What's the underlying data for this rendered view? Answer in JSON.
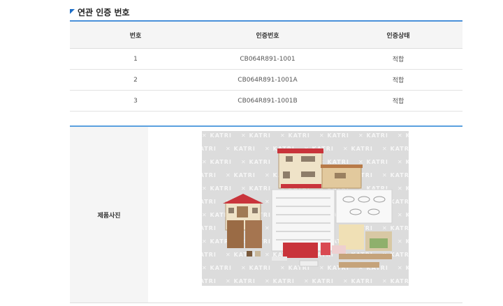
{
  "section": {
    "title": "연관 인증 번호"
  },
  "table": {
    "headers": [
      "번호",
      "인증번호",
      "인증상태"
    ],
    "rows": [
      [
        "1",
        "CB064R891-1001",
        "적합"
      ],
      [
        "2",
        "CB064R891-1001A",
        "적합"
      ],
      [
        "3",
        "CB064R891-1001B",
        "적합"
      ]
    ]
  },
  "photo": {
    "label": "제품사진",
    "watermark": "KATRI"
  }
}
